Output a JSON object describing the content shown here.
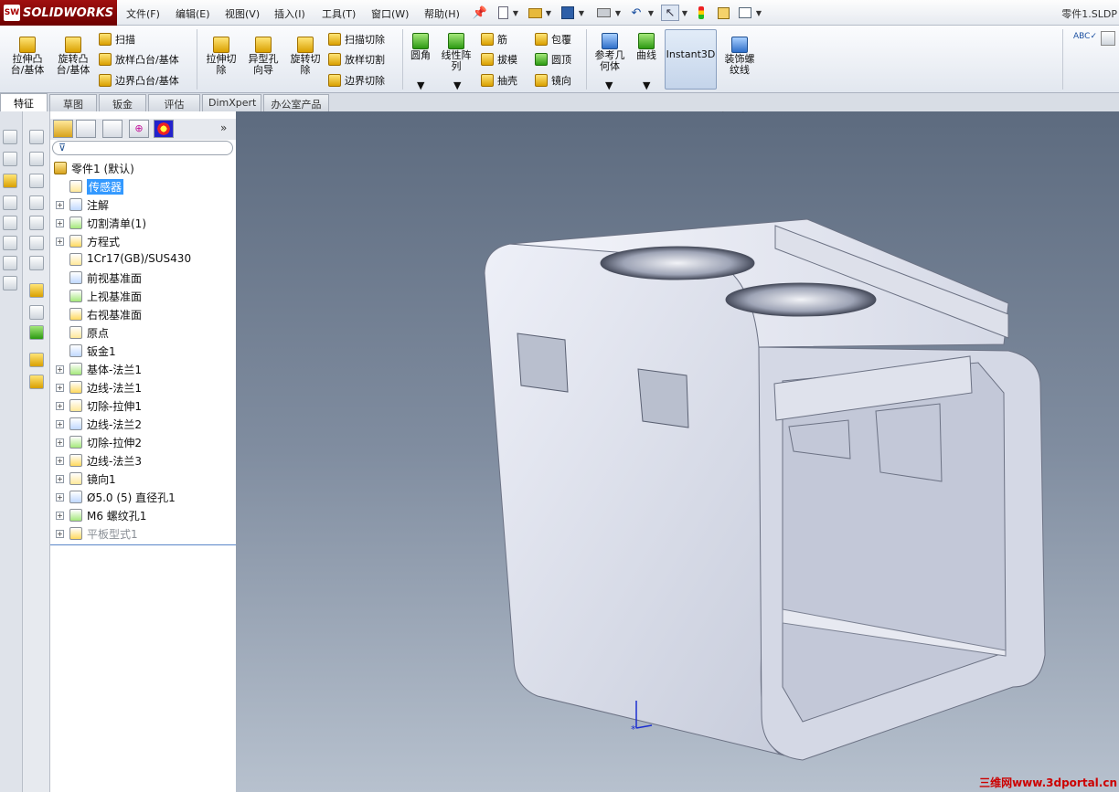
{
  "app": {
    "logo_text": "SOLIDWORKS",
    "window_title": "零件1.SLDP"
  },
  "menu": [
    "文件(F)",
    "编辑(E)",
    "视图(V)",
    "插入(I)",
    "工具(T)",
    "窗口(W)",
    "帮助(H)"
  ],
  "ribbon": {
    "extrude_boss": "拉伸凸台/基体",
    "revolve_boss": "旋转凸台/基体",
    "sweep": "扫描",
    "loft_boss": "放样凸台/基体",
    "boundary_boss": "边界凸台/基体",
    "extrude_cut": "拉伸切除",
    "hole_wizard": "异型孔向导",
    "revolve_cut": "旋转切除",
    "sweep_cut": "扫描切除",
    "loft_cut": "放样切割",
    "boundary_cut": "边界切除",
    "fillet": "圆角",
    "linear_pattern": "线性阵列",
    "rib": "筋",
    "draft": "拔模",
    "shell": "抽壳",
    "wrap": "包覆",
    "dome": "圆顶",
    "mirror": "镜向",
    "ref_geometry": "参考几何体",
    "curves": "曲线",
    "instant3d": "Instant3D",
    "cosmetic_thread": "装饰螺纹线"
  },
  "tabs": [
    "特征",
    "草图",
    "钣金",
    "评估",
    "DimXpert",
    "办公室产品"
  ],
  "tree": {
    "root": "零件1 (默认)",
    "items": [
      {
        "label": "传感器",
        "selected": true,
        "expandable": false
      },
      {
        "label": "注解",
        "expandable": true
      },
      {
        "label": "切割清单(1)",
        "expandable": true
      },
      {
        "label": "方程式",
        "expandable": true
      },
      {
        "label": "1Cr17(GB)/SUS430",
        "expandable": false
      },
      {
        "label": "前视基准面",
        "expandable": false
      },
      {
        "label": "上视基准面",
        "expandable": false
      },
      {
        "label": "右视基准面",
        "expandable": false
      },
      {
        "label": "原点",
        "expandable": false
      },
      {
        "label": "钣金1",
        "expandable": false
      },
      {
        "label": "基体-法兰1",
        "expandable": true
      },
      {
        "label": "边线-法兰1",
        "expandable": true
      },
      {
        "label": "切除-拉伸1",
        "expandable": true
      },
      {
        "label": "边线-法兰2",
        "expandable": true
      },
      {
        "label": "切除-拉伸2",
        "expandable": true
      },
      {
        "label": "边线-法兰3",
        "expandable": true
      },
      {
        "label": "镜向1",
        "expandable": true
      },
      {
        "label": "Ø5.0 (5) 直径孔1",
        "expandable": true
      },
      {
        "label": "M6 螺纹孔1",
        "expandable": true
      },
      {
        "label": "平板型式1",
        "expandable": true,
        "dim": true
      }
    ]
  },
  "watermark": "三维网www.3dportal.cn"
}
